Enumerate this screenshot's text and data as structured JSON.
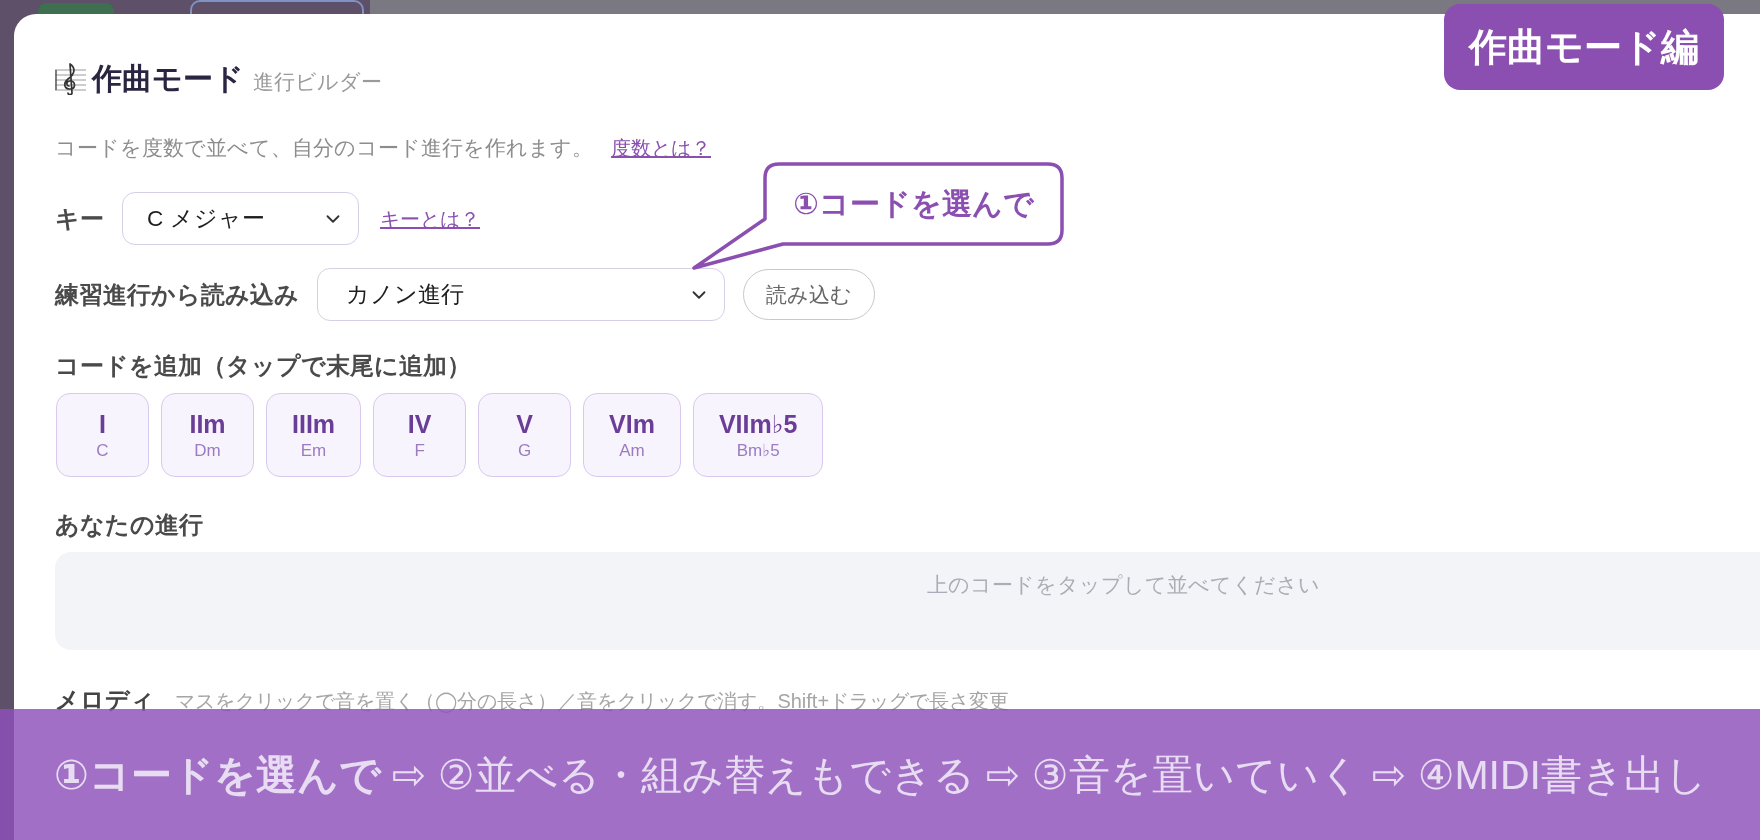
{
  "banner": {
    "text": "作曲モード編"
  },
  "header": {
    "title": "作曲モード",
    "subtitle": "進行ビルダー"
  },
  "intro": {
    "text": "コードを度数で並べて、自分のコード進行を作れます。",
    "link": "度数とは？"
  },
  "key": {
    "label": "キー",
    "value": "C メジャー",
    "link": "キーとは？"
  },
  "preset": {
    "label": "練習進行から読み込み",
    "value": "カノン進行",
    "button": "読み込む"
  },
  "callout": {
    "text": "①コードを選んで"
  },
  "chord_palette": {
    "title": "コードを追加（タップで末尾に追加）",
    "chords": [
      {
        "degree": "I",
        "name": "C"
      },
      {
        "degree": "IIm",
        "name": "Dm"
      },
      {
        "degree": "IIIm",
        "name": "Em"
      },
      {
        "degree": "IV",
        "name": "F"
      },
      {
        "degree": "V",
        "name": "G"
      },
      {
        "degree": "VIm",
        "name": "Am"
      },
      {
        "degree": "VIIm♭5",
        "name": "Bm♭5"
      }
    ]
  },
  "progression": {
    "title": "あなたの進行",
    "empty_message": "上のコードをタップして並べてください"
  },
  "melody": {
    "title": "メロディ",
    "hint": "マスをクリックで音を置く（◯分の長さ）／音をクリックで消す。Shift+ドラッグで長さ変更"
  },
  "caption": {
    "text": "**①コードを選んで** ⇨ ②並べる・組み替えもできる ⇨ ③音を置いていく ⇨ ④MIDI書き出し"
  }
}
